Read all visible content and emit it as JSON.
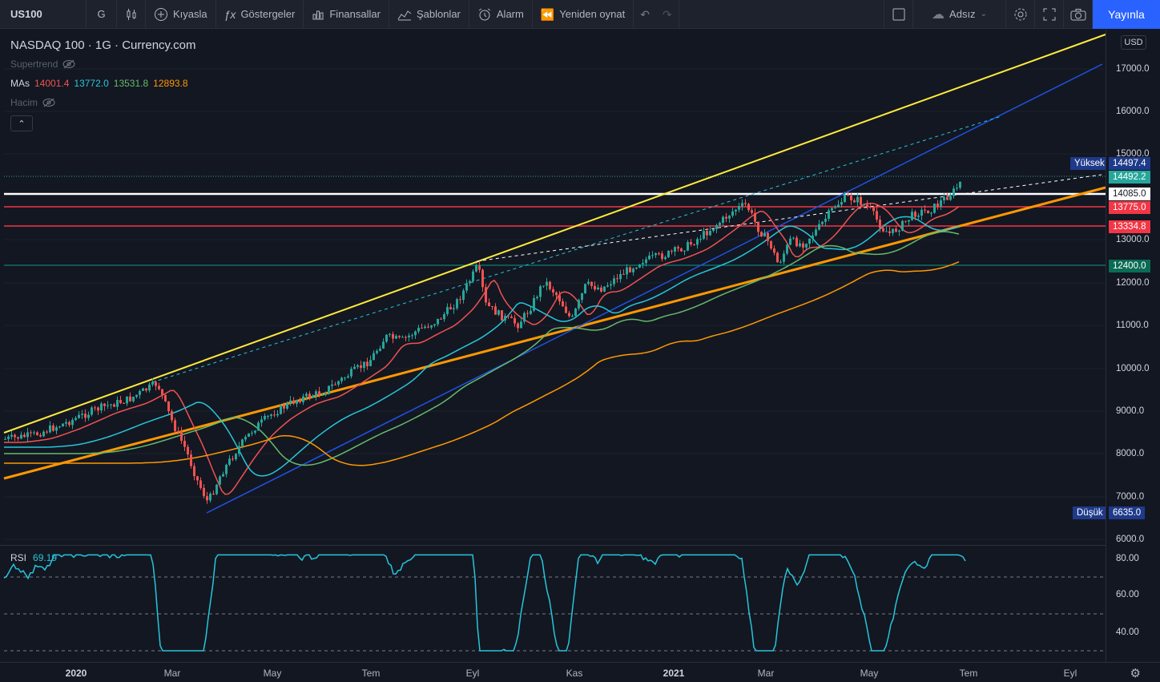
{
  "toolbar": {
    "symbol": "US100",
    "interval": "G",
    "compare": "Kıyasla",
    "indicators": "Göstergeler",
    "financials": "Finansallar",
    "templates": "Şablonlar",
    "alert": "Alarm",
    "replay": "Yeniden oynat",
    "layout_name": "Adsız",
    "publish": "Yayınla"
  },
  "legend": {
    "title": "NASDAQ 100 · 1G · Currency.com",
    "supertrend": "Supertrend",
    "mas_label": "MAs",
    "ma_values": [
      {
        "value": "14001.4",
        "color": "#ef5350"
      },
      {
        "value": "13772.0",
        "color": "#26c6da"
      },
      {
        "value": "13531.8",
        "color": "#66bb6a"
      },
      {
        "value": "12893.8",
        "color": "#ff9800"
      }
    ],
    "volume": "Hacim"
  },
  "price_axis": {
    "currency": "USD",
    "ticks": [
      "17000.0",
      "16000.0",
      "15000.0",
      "13000.0",
      "12000.0",
      "11000.0",
      "10000.0",
      "9000.0",
      "8000.0",
      "7000.0",
      "6000.0"
    ]
  },
  "price_tags": {
    "high_label": "Yüksek",
    "high_value": "14497.4",
    "last_price": "14492.2",
    "white_line": "14085.0",
    "red_line_1": "13775.0",
    "red_line_2": "13334.8",
    "green_line": "12400.0",
    "low_label": "Düşük",
    "low_value": "6635.0"
  },
  "rsi": {
    "label": "RSI",
    "value": "69.19",
    "ticks": [
      "80.00",
      "60.00",
      "40.00"
    ]
  },
  "time_axis": {
    "labels": [
      {
        "text": "2020",
        "bold": true
      },
      {
        "text": "Mar",
        "bold": false
      },
      {
        "text": "May",
        "bold": false
      },
      {
        "text": "Tem",
        "bold": false
      },
      {
        "text": "Eyl",
        "bold": false
      },
      {
        "text": "Kas",
        "bold": false
      },
      {
        "text": "2021",
        "bold": true
      },
      {
        "text": "Mar",
        "bold": false
      },
      {
        "text": "May",
        "bold": false
      },
      {
        "text": "Tem",
        "bold": false
      },
      {
        "text": "Eyl",
        "bold": false
      }
    ]
  },
  "colors": {
    "background": "#131722",
    "up": "#26a69a",
    "down": "#ef5350",
    "accent": "#2962ff"
  }
}
